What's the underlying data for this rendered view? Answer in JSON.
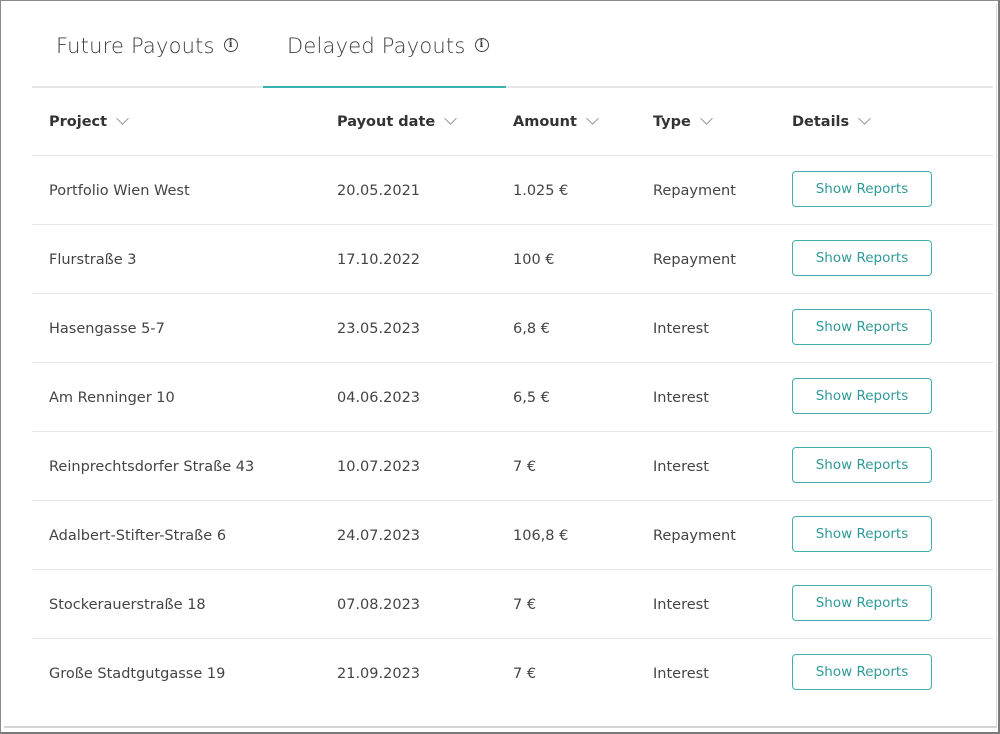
{
  "tabs": [
    {
      "label": "Future Payouts",
      "active": false
    },
    {
      "label": "Delayed Payouts",
      "active": true
    }
  ],
  "info_icon": "info-circle-icon",
  "accent_color": "#36b4b2",
  "table": {
    "columns": [
      "Project",
      "Payout date",
      "Amount",
      "Type",
      "Details"
    ],
    "sort_icon": "chevron-down-icon",
    "rows": [
      {
        "project": "Portfolio Wien West",
        "date": "20.05.2021",
        "amount": "1.025 €",
        "type": "Repayment",
        "action": "Show Reports"
      },
      {
        "project": "Flurstraße 3",
        "date": "17.10.2022",
        "amount": "100 €",
        "type": "Repayment",
        "action": "Show Reports"
      },
      {
        "project": "Hasengasse 5-7",
        "date": "23.05.2023",
        "amount": "6,8 €",
        "type": "Interest",
        "action": "Show Reports"
      },
      {
        "project": "Am Renninger 10",
        "date": "04.06.2023",
        "amount": "6,5 €",
        "type": "Interest",
        "action": "Show Reports"
      },
      {
        "project": "Reinprechtsdorfer Straße 43",
        "date": "10.07.2023",
        "amount": "7 €",
        "type": "Interest",
        "action": "Show Reports"
      },
      {
        "project": "Adalbert-Stifter-Straße 6",
        "date": "24.07.2023",
        "amount": "106,8 €",
        "type": "Repayment",
        "action": "Show Reports"
      },
      {
        "project": "Stockerauerstraße 18",
        "date": "07.08.2023",
        "amount": "7 €",
        "type": "Interest",
        "action": "Show Reports"
      },
      {
        "project": "Große Stadtgutgasse 19",
        "date": "21.09.2023",
        "amount": "7 €",
        "type": "Interest",
        "action": "Show Reports"
      }
    ]
  }
}
